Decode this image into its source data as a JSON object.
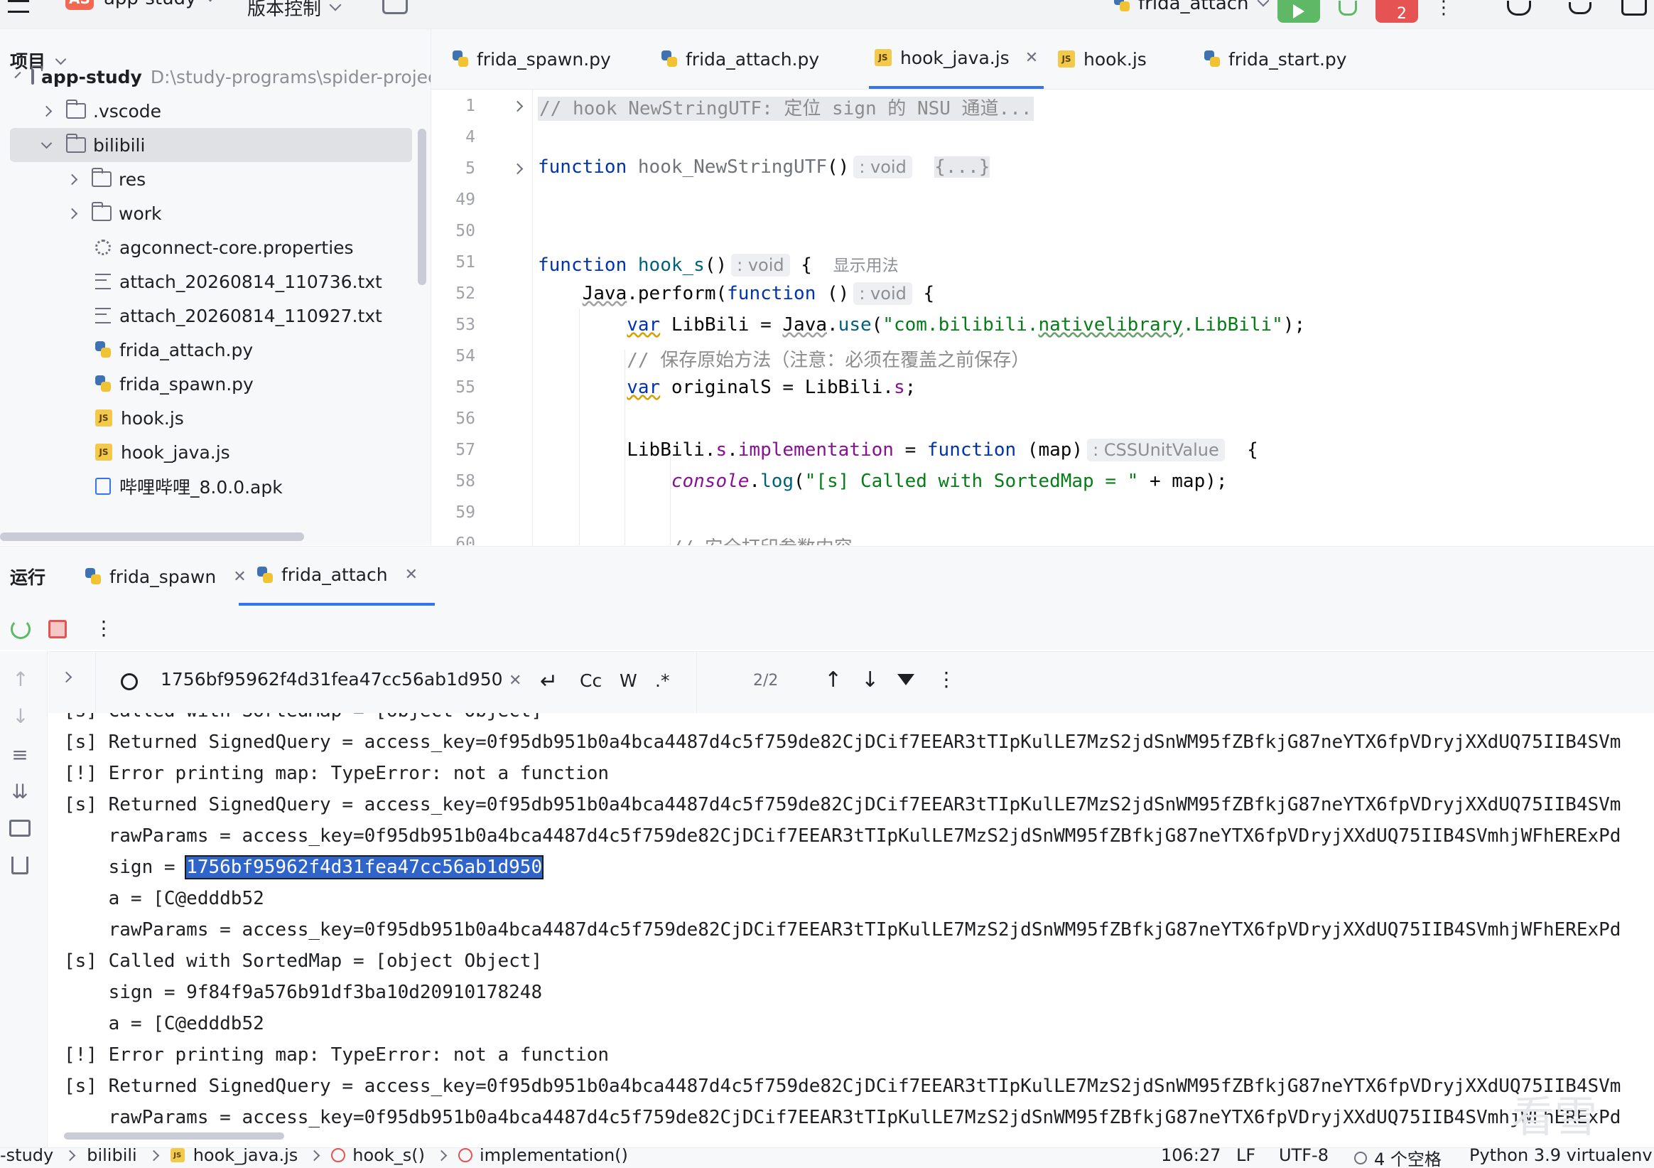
{
  "topbar": {
    "project_avatar": "AS",
    "project_name": "app-study",
    "vcs_label": "版本控制",
    "run_config": "frida_attach",
    "badge_count": "2"
  },
  "project": {
    "title": "项目",
    "root_name": "app-study",
    "root_path": "D:\\study-programs\\spider-projec",
    "items": [
      {
        "label": ".vscode"
      },
      {
        "label": "bilibili"
      },
      {
        "label": "res"
      },
      {
        "label": "work"
      },
      {
        "label": "agconnect-core.properties"
      },
      {
        "label": "attach_20260814_110736.txt"
      },
      {
        "label": "attach_20260814_110927.txt"
      },
      {
        "label": "frida_attach.py"
      },
      {
        "label": "frida_spawn.py"
      },
      {
        "label": "hook.js"
      },
      {
        "label": "hook_java.js"
      },
      {
        "label": "哔哩哔哩_8.0.0.apk"
      }
    ]
  },
  "editor": {
    "tabs": [
      {
        "label": "frida_spawn.py"
      },
      {
        "label": "frida_attach.py"
      },
      {
        "label": "hook_java.js"
      },
      {
        "label": "hook.js"
      },
      {
        "label": "frida_start.py"
      }
    ],
    "line_numbers": [
      "1",
      "4",
      "5",
      "49",
      "50",
      "51",
      "52",
      "53",
      "54",
      "55",
      "56",
      "57",
      "58",
      "59",
      "60"
    ],
    "hints": {
      "void": ": void",
      "css": ": CSSUnitValue"
    },
    "usage_hint": "显示用法",
    "code": {
      "l1": "// hook NewStringUTF: 定位 sign 的 NSU 通道...",
      "l5_kw": "function",
      "l5_fn": "hook_NewStringUTF",
      "l5_paren": "()",
      "l5_body": "{...}",
      "l51_kw": "function",
      "l51_fn": "hook_s",
      "l51_paren": "()",
      "l51_brace": "{",
      "l52_a": "Java",
      "l52_b": ".perform(",
      "l52_kw": "function",
      "l52_c": " ()",
      "l52_brace": "{",
      "l53_kw": "var",
      "l53_a": " LibBili = ",
      "l53_b": "Java",
      "l53_c": ".",
      "l53_use": "use",
      "l53_d": "(",
      "l53_str1": "\"com.bilibili.",
      "l53_str2": "nativelibrary",
      "l53_str3": ".LibBili\"",
      "l53_e": ");",
      "l54": "// 保存原始方法（注意：必须在覆盖之前保存）",
      "l55_kw": "var",
      "l55_a": " originalS = LibBili.",
      "l55_prop": "s",
      "l55_b": ";",
      "l57_a": "LibBili.",
      "l57_prop": "s",
      "l57_b": ".",
      "l57_impl": "implementation",
      "l57_c": " = ",
      "l57_kw": "function",
      "l57_d": " (map)",
      "l57_brace": "{",
      "l58_console": "console",
      "l58_a": ".",
      "l58_log": "log",
      "l58_b": "(",
      "l58_str": "\"[s] Called with SortedMap = \"",
      "l58_c": " + map);",
      "l60": "// 安全打印参数内容"
    }
  },
  "run": {
    "title": "运行",
    "tabs": [
      {
        "label": "frida_spawn"
      },
      {
        "label": "frida_attach"
      }
    ],
    "search_query": "1756bf95962f4d31fea47cc56ab1d950",
    "match_case": "Cc",
    "words": "W",
    "regex": ".*",
    "match_count": "2/2",
    "console_lines": [
      "[s] Called with SortedMap = [object Object]",
      "[s] Returned SignedQuery = access_key=0f95db951b0a4bca4487d4c5f759de82CjDCif7EEAR3tTIpKulLE7MzS2jdSnWM95fZBfkjG87neYTX6fpVDryjXXdUQ75IIB4SVm",
      "[!] Error printing map: TypeError: not a function",
      "[s] Returned SignedQuery = access_key=0f95db951b0a4bca4487d4c5f759de82CjDCif7EEAR3tTIpKulLE7MzS2jdSnWM95fZBfkjG87neYTX6fpVDryjXXdUQ75IIB4SVm",
      "    rawParams = access_key=0f95db951b0a4bca4487d4c5f759de82CjDCif7EEAR3tTIpKulLE7MzS2jdSnWM95fZBfkjG87neYTX6fpVDryjXXdUQ75IIB4SVmhjWFhERExPd",
      "    a = [C@edddb52",
      "    rawParams = access_key=0f95db951b0a4bca4487d4c5f759de82CjDCif7EEAR3tTIpKulLE7MzS2jdSnWM95fZBfkjG87neYTX6fpVDryjXXdUQ75IIB4SVmhjWFhERExPd",
      "[s] Called with SortedMap = [object Object]",
      "    sign = 9f84f9a576b91df3ba10d20910178248",
      "    a = [C@edddb52",
      "[!] Error printing map: TypeError: not a function",
      "[s] Returned SignedQuery = access_key=0f95db951b0a4bca4487d4c5f759de82CjDCif7EEAR3tTIpKulLE7MzS2jdSnWM95fZBfkjG87neYTX6fpVDryjXXdUQ75IIB4SVm",
      "    rawParams = access_key=0f95db951b0a4bca4487d4c5f759de82CjDCif7EEAR3tTIpKulLE7MzS2jdSnWM95fZBfkjG87neYTX6fpVDryjXXdUQ75IIB4SVmhjWFhERExPd"
    ],
    "sign_prefix": "    sign = ",
    "sign_value": "1756bf95962f4d31fea47cc56ab1d950"
  },
  "statusbar": {
    "crumbs": [
      "-study",
      "bilibili",
      "hook_java.js",
      "hook_s()",
      "implementation()"
    ],
    "position": "106:27",
    "line_sep": "LF",
    "encoding": "UTF-8",
    "indent": "4 个空格",
    "interpreter": "Python 3.9 virtualenv",
    "watermark": "看雪"
  },
  "colors": {
    "accent": "#3574f0",
    "run_green": "#5fb865",
    "badge_red": "#e55353",
    "avatar": "#f26852"
  }
}
